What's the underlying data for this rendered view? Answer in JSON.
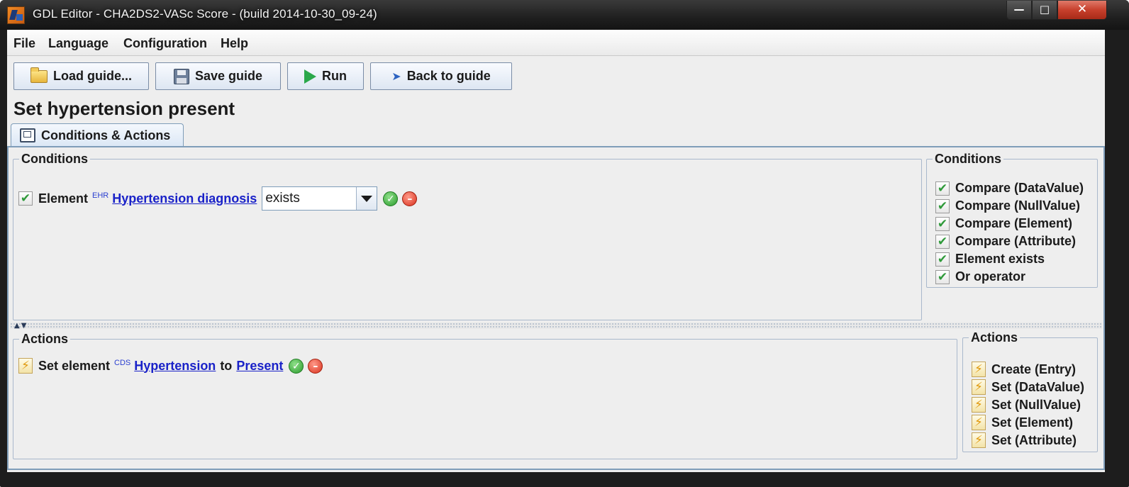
{
  "window": {
    "title": "GDL Editor - CHA2DS2-VASc Score - (build 2014-10-30_09-24)"
  },
  "menu": [
    "File",
    "Language",
    "Configuration",
    "Help"
  ],
  "toolbar": {
    "load_label": "Load guide...",
    "save_label": "Save guide",
    "run_label": "Run",
    "back_label": "Back to guide"
  },
  "page_title": "Set hypertension present",
  "tab": {
    "label": "Conditions & Actions"
  },
  "conditions": {
    "legend": "Conditions",
    "rows": [
      {
        "prefix": "Element",
        "source_tag": "EHR",
        "element_link": "Hypertension diagnosis",
        "operator": "exists"
      }
    ]
  },
  "conditions_palette": {
    "legend": "Conditions",
    "items": [
      "Compare (DataValue)",
      "Compare (NullValue)",
      "Compare (Element)",
      "Compare (Attribute)",
      "Element exists",
      "Or operator"
    ]
  },
  "actions": {
    "legend": "Actions",
    "rows": [
      {
        "prefix": "Set element",
        "source_tag": "CDS",
        "element_link": "Hypertension",
        "connector": "to",
        "value_link": "Present"
      }
    ]
  },
  "actions_palette": {
    "legend": "Actions",
    "items": [
      "Create (Entry)",
      "Set (DataValue)",
      "Set (NullValue)",
      "Set (Element)",
      "Set (Attribute)"
    ]
  },
  "icons": {
    "check": "checkmark-icon",
    "bolt": "lightning-icon",
    "accept": "green-check-circle-icon",
    "remove": "red-minus-circle-icon"
  },
  "colors": {
    "link": "#1a22c8",
    "tag": "#2a3fd0",
    "panel_border": "#7f9db9"
  }
}
